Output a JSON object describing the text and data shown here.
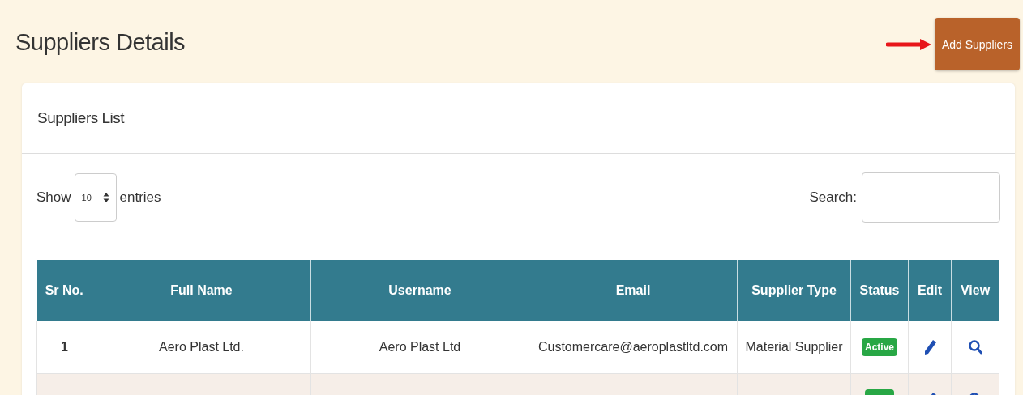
{
  "page": {
    "title": "Suppliers Details",
    "add_button": "Add Suppliers"
  },
  "card": {
    "title": "Suppliers List",
    "show_label": "Show",
    "page_size": "10",
    "entries_label": "entries",
    "search_label": "Search:"
  },
  "table": {
    "columns": [
      "Sr No.",
      "Full Name",
      "Username",
      "Email",
      "Supplier Type",
      "Status",
      "Edit",
      "View"
    ],
    "rows": [
      {
        "sr_no": "1",
        "full_name": "Aero Plast Ltd.",
        "username": "Aero Plast Ltd",
        "email": "Customercare@aeroplastltd.com",
        "supplier_type": "Material Supplier",
        "status": "Active",
        "active": true
      },
      {
        "active": true
      }
    ]
  }
}
